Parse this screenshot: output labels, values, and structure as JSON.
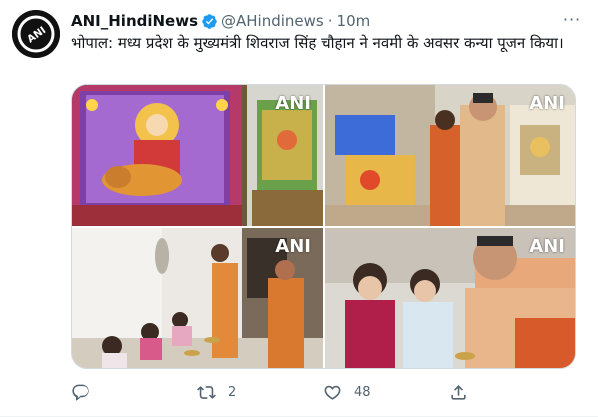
{
  "tweet": {
    "avatar_text": "ANI",
    "display_name": "ANI_HindiNews",
    "handle": "@AHindinews",
    "separator": "·",
    "time": "10m",
    "text": "भोपाल: मध्य प्रदेश के मुख्यमंत्री शिवराज सिंह चौहान ने नवमी के अवसर कन्या पूजन किया।",
    "more_label": "···"
  },
  "media": {
    "watermark": "ANI",
    "photos": [
      "photo-1",
      "photo-2",
      "photo-3",
      "photo-4"
    ]
  },
  "actions": {
    "reply_count": "",
    "retweet_count": "2",
    "like_count": "48",
    "share_count": ""
  },
  "icons": {
    "reply": "comment-icon",
    "retweet": "retweet-icon",
    "like": "heart-icon",
    "share": "share-icon",
    "verified": "verified-badge-icon",
    "more": "more-icon"
  },
  "colors": {
    "text": "#0f1419",
    "muted": "#536471",
    "verified": "#1d9bf0",
    "border": "#cfd9de"
  }
}
